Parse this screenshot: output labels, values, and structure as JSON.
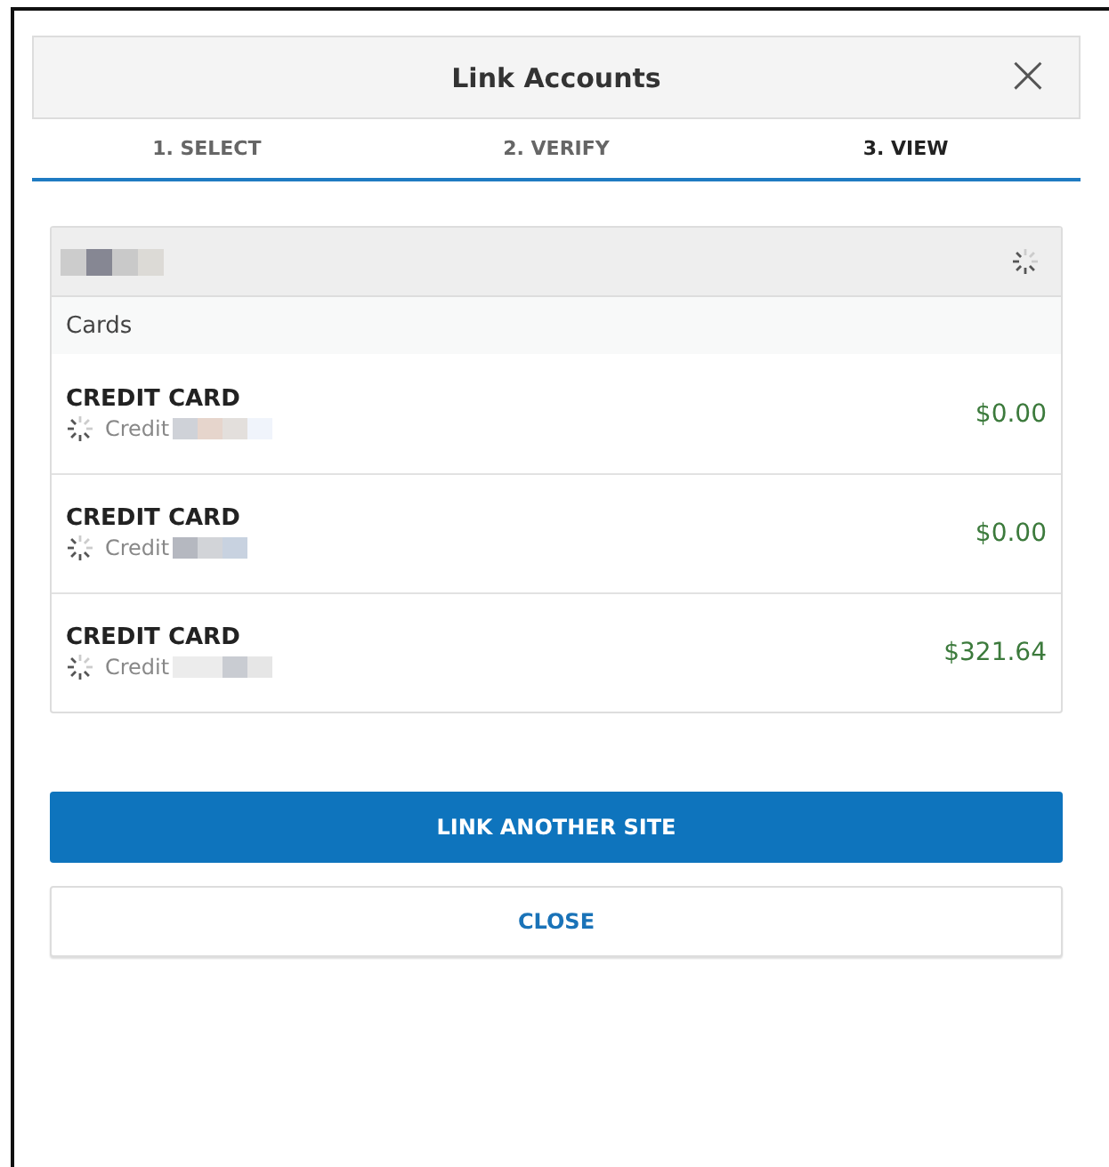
{
  "dialog": {
    "title": "Link Accounts",
    "close": "×"
  },
  "steps": [
    {
      "label": "1. SELECT",
      "selected": false
    },
    {
      "label": "2. VERIFY",
      "selected": false
    },
    {
      "label": "3. VIEW",
      "selected": true
    }
  ],
  "account_group": {
    "section": "Cards",
    "accounts": [
      {
        "name": "CREDIT CARD",
        "type": "Credit",
        "balance": "$0.00"
      },
      {
        "name": "CREDIT CARD",
        "type": "Credit",
        "balance": "$0.00"
      },
      {
        "name": "CREDIT CARD",
        "type": "Credit",
        "balance": "$321.64"
      }
    ]
  },
  "buttons": [
    {
      "label": "LINK ANOTHER SITE",
      "kind": "primary"
    },
    {
      "label": "CLOSE",
      "kind": "secondary"
    }
  ]
}
